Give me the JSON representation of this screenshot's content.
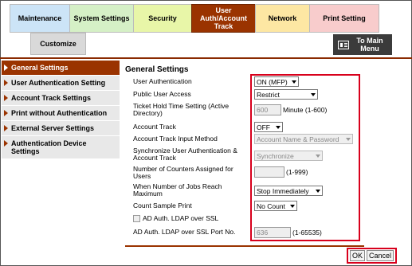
{
  "tabs": {
    "maintenance": "Maintenance",
    "system": "System Settings",
    "security": "Security",
    "user": "User Auth/Account Track",
    "network": "Network",
    "print": "Print Setting"
  },
  "customize": "Customize",
  "to_main": "To Main Menu",
  "sidebar": {
    "items": [
      {
        "label": "General Settings"
      },
      {
        "label": "User Authentication Setting"
      },
      {
        "label": "Account Track Settings"
      },
      {
        "label": "Print without Authentication"
      },
      {
        "label": "External Server Settings"
      },
      {
        "label": "Authentication Device Settings"
      }
    ]
  },
  "main": {
    "title": "General Settings",
    "fields": {
      "user_auth": {
        "label": "User Authentication",
        "value": "ON (MFP)"
      },
      "public_access": {
        "label": "Public User Access",
        "value": "Restrict"
      },
      "ticket_hold": {
        "label": "Ticket Hold Time Setting (Active Directory)",
        "value": "600",
        "suffix": "Minute (1-600)"
      },
      "account_track": {
        "label": "Account Track",
        "value": "OFF"
      },
      "input_method": {
        "label": "Account Track Input Method",
        "value": "Account Name & Password"
      },
      "sync": {
        "label": "Synchronize User Authentication & Account Track",
        "value": "Synchronize"
      },
      "counters": {
        "label": "Number of Counters Assigned for Users",
        "value": "",
        "suffix": "(1-999)"
      },
      "jobs_max": {
        "label": "When Number of Jobs Reach Maximum",
        "value": "Stop Immediately"
      },
      "count_sample": {
        "label": "Count Sample Print",
        "value": "No Count"
      },
      "ldap_ssl": {
        "label": "AD Auth. LDAP over SSL"
      },
      "ldap_port": {
        "label": "AD Auth. LDAP over SSL Port No.",
        "value": "636",
        "suffix": "(1-65535)"
      }
    }
  },
  "buttons": {
    "ok": "OK",
    "cancel": "Cancel"
  },
  "colors": {
    "accent": "#9a3300",
    "highlight": "#d8001c"
  }
}
